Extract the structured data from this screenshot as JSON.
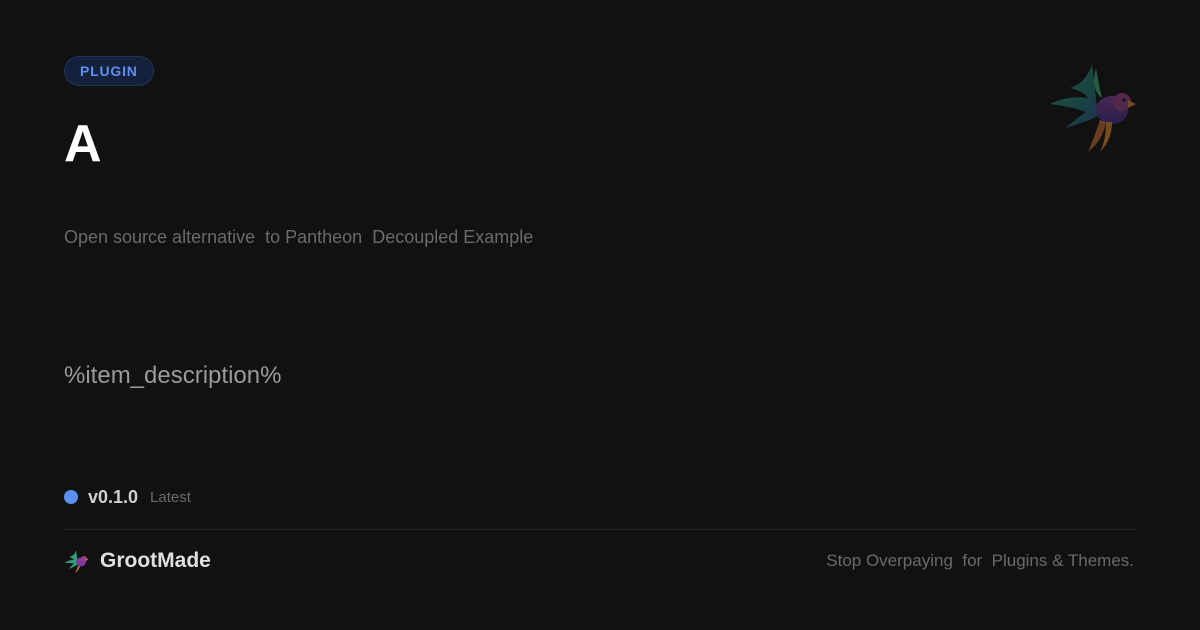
{
  "badge": {
    "label": "PLUGIN"
  },
  "title": "A",
  "subtitle": "Open source alternative  to Pantheon  Decoupled Example",
  "description": "%item_description%",
  "version": {
    "number": "v0.1.0",
    "status": "Latest",
    "dot_color": "#5b8ff0"
  },
  "brand": {
    "name": "GrootMade",
    "logo_icon": "parrot-logo-icon"
  },
  "tagline": "Stop Overpaying  for  Plugins & Themes.",
  "colors": {
    "background": "#111111",
    "accent": "#5b8ff0"
  }
}
